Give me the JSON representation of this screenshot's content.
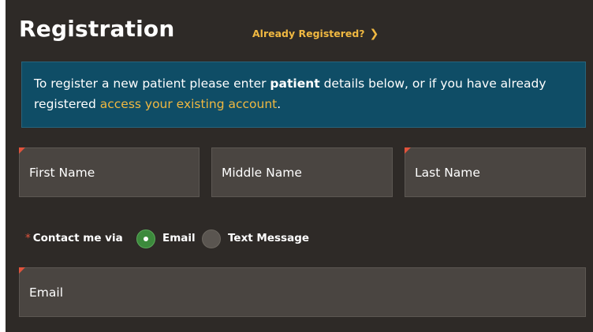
{
  "header": {
    "title": "Registration",
    "already_registered": "Already Registered?",
    "chevron_icon": "chevron-right-icon"
  },
  "info": {
    "text_before": "To register a new patient please enter ",
    "bold_word": "patient",
    "text_after": " details below, or if you have already registered ",
    "link_text": "access your existing account",
    "text_end": "."
  },
  "form": {
    "first_name": "First Name",
    "middle_name": "Middle Name",
    "last_name": "Last Name",
    "contact_label": "Contact me via",
    "contact_required_mark": "*",
    "contact_options": [
      {
        "label": "Email",
        "selected": true
      },
      {
        "label": "Text Message",
        "selected": false
      }
    ],
    "email": "Email"
  },
  "colors": {
    "background": "#2e2a27",
    "accent": "#f0b841",
    "info_bg": "#0f4d66",
    "field_bg": "#4a4541",
    "required": "#e0533c",
    "radio_selected": "#3c8a3c"
  }
}
